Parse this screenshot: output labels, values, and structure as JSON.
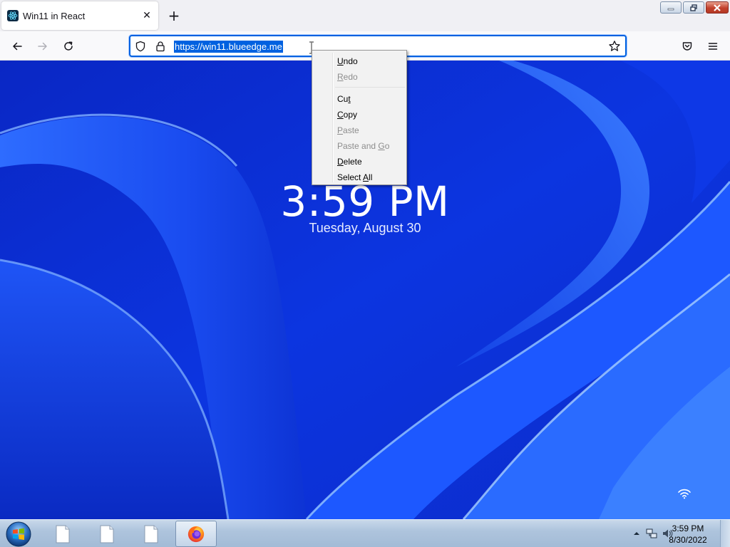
{
  "browser": {
    "tab": {
      "title": "Win11 in React",
      "close_glyph": "✕",
      "favicon": "react-atom-icon"
    },
    "new_tab_glyph": "+",
    "window_controls": {
      "minimize": "minimize-icon",
      "restore": "restore-icon",
      "close": "close-icon"
    },
    "nav": {
      "back": "back-arrow-icon",
      "forward": "forward-arrow-icon",
      "reload": "reload-icon"
    },
    "urlbar": {
      "url": "https://win11.blueedge.me",
      "selected": true,
      "shield": "shield-icon",
      "lock": "lock-icon",
      "bookmark": "star-icon"
    },
    "toolbar_right": {
      "pocket": "pocket-icon",
      "menu": "hamburger-menu-icon"
    },
    "colors": {
      "accent": "#0061e0",
      "chrome_bg": "#f0f0f4"
    }
  },
  "context_menu": {
    "items": [
      {
        "label_pre": "",
        "accel": "U",
        "label_post": "ndo",
        "enabled": true
      },
      {
        "label_pre": "",
        "accel": "R",
        "label_post": "edo",
        "enabled": false
      },
      {
        "separator": true
      },
      {
        "label_pre": "Cu",
        "accel": "t",
        "label_post": "",
        "enabled": true
      },
      {
        "label_pre": "",
        "accel": "C",
        "label_post": "opy",
        "enabled": true
      },
      {
        "label_pre": "",
        "accel": "P",
        "label_post": "aste",
        "enabled": false
      },
      {
        "label_pre": "Paste and ",
        "accel": "G",
        "label_post": "o",
        "enabled": false
      },
      {
        "label_pre": "",
        "accel": "D",
        "label_post": "elete",
        "enabled": true
      },
      {
        "label_pre": "Select ",
        "accel": "A",
        "label_post": "ll",
        "enabled": true
      }
    ]
  },
  "lockscreen": {
    "time": "3:59 PM",
    "date": "Tuesday, August 30",
    "wifi": "wifi-icon",
    "colors": {
      "wallpaper": "#0b2fd6"
    }
  },
  "taskbar": {
    "start": "windows-start-orb-icon",
    "apps": [
      {
        "name": "document-icon",
        "active": false
      },
      {
        "name": "document-icon",
        "active": false
      },
      {
        "name": "document-icon",
        "active": false
      },
      {
        "name": "firefox-icon",
        "active": true
      }
    ],
    "tray": {
      "show_hidden": "show-hidden-icons-arrow",
      "network": "network-icon",
      "volume": "volume-icon",
      "time": "3:59 PM",
      "date": "8/30/2022"
    }
  }
}
